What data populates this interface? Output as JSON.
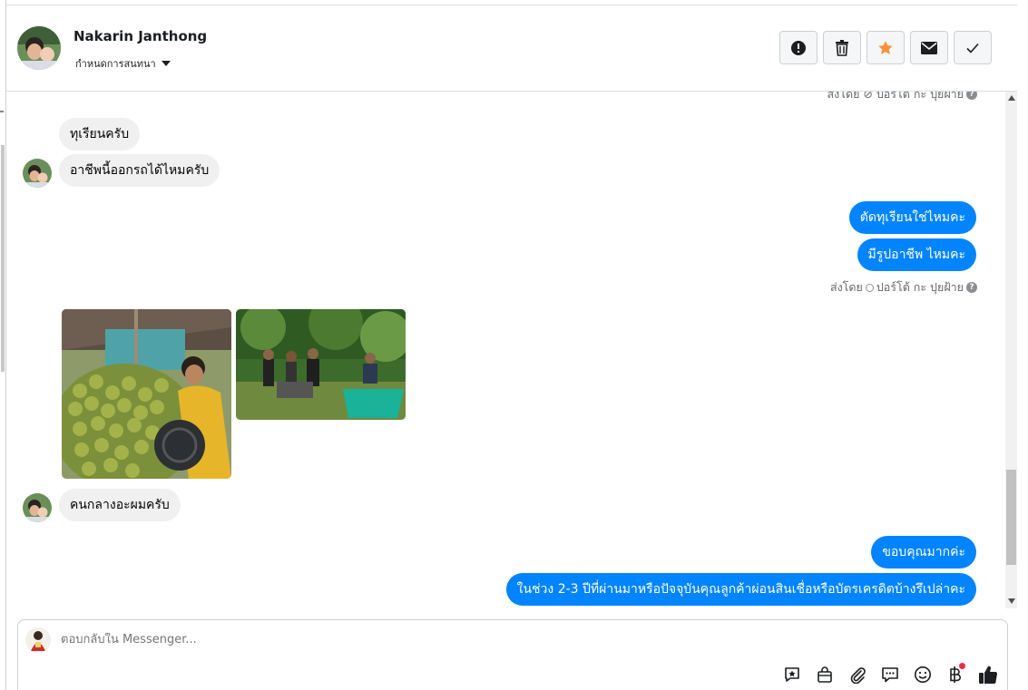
{
  "header": {
    "contact_name": "Nakarin Janthong",
    "conversation_settings": "กำหนดการสนทนา",
    "actions": [
      {
        "name": "report-icon"
      },
      {
        "name": "trash-icon"
      },
      {
        "name": "star-icon",
        "color": "#f7923b"
      },
      {
        "name": "mail-icon"
      },
      {
        "name": "check-icon"
      }
    ]
  },
  "thread": {
    "sent_by_top": "ส่งโดย ⊘ ปอร์โต้ กะ ปุยฝ้าย",
    "msg_in_1": "ทุเรียนครับ",
    "msg_in_2": "อาชีพนี้ออกรถได้ไหมครับ",
    "msg_out_1": "ตัดทุเรียนใช่ไหมคะ",
    "msg_out_2": "มีรูปอาชีพ ไหมคะ",
    "sent_by_label": "ส่งโดย",
    "sent_by_names": "ปอร์โต้ กะ ปุยฝ้าย",
    "msg_in_3": "คนกลางอะผมครับ",
    "msg_out_3": "ขอบคุณมากค่ะ",
    "msg_out_4": "ในช่วง 2-3 ปีที่ผ่านมาหรือปัจจุบันคุณลูกค้าผ่อนสินเชื่อหรือบัตรเครดิตบ้างรึเปล่าคะ"
  },
  "composer": {
    "placeholder": "ตอบกลับใน Messenger...",
    "tools": [
      "saved-reply-icon",
      "shop-icon",
      "attachment-icon",
      "chat-bubble-icon",
      "emoji-icon",
      "baht-icon",
      "like-icon"
    ]
  },
  "colors": {
    "outgoing_bubble": "#0084ff",
    "incoming_bubble": "#f0f0f0"
  }
}
